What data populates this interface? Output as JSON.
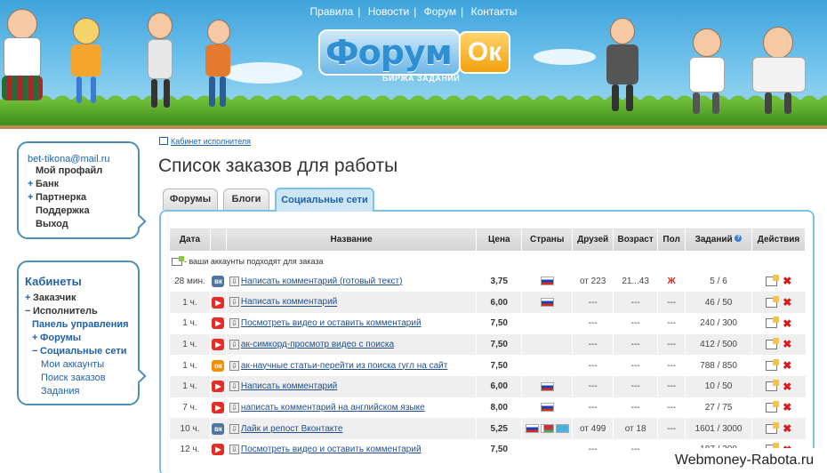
{
  "header": {
    "nav": [
      "Правила",
      "Новости",
      "Форум",
      "Контакты"
    ],
    "nav_sep": "|",
    "logo_main": "Форум",
    "logo_badge": "Ок",
    "logo_sub": "БИРЖА ЗАДАНИЙ"
  },
  "account": {
    "email": "bet-tikona@mail.ru",
    "items": [
      {
        "prefix": "",
        "label": "Мой профайл"
      },
      {
        "prefix": "+",
        "label": "Банк"
      },
      {
        "prefix": "+",
        "label": "Партнерка"
      },
      {
        "prefix": "",
        "label": "Поддержка"
      },
      {
        "prefix": "",
        "label": "Выход"
      }
    ]
  },
  "cabinets": {
    "title": "Кабинеты",
    "customer": {
      "prefix": "+",
      "label": "Заказчик"
    },
    "executor": {
      "prefix": "−",
      "label": "Исполнитель"
    },
    "control_panel": "Панель управления",
    "forums": {
      "prefix": "+",
      "label": "Форумы"
    },
    "social": {
      "prefix": "−",
      "label": "Социальные сети"
    },
    "social_items": [
      "Мои аккаунты",
      "Поиск заказов",
      "Задания"
    ]
  },
  "breadcrumb": "Кабинет исполнителя",
  "page_title": "Список заказов для работы",
  "tabs": [
    "Форумы",
    "Блоги",
    "Социальные сети"
  ],
  "table": {
    "headers": [
      "Дата",
      "",
      "Название",
      "Цена",
      "Страны",
      "Друзей",
      "Возраст",
      "Пол",
      "Заданий",
      "Действия"
    ],
    "help_mark": "?",
    "note": "- ваши аккаунты подходят для заказа",
    "rows": [
      {
        "date": "28 мин.",
        "service": "vk",
        "service_glyph": "вк",
        "name": "Написать комментарий (готовый текст)",
        "price": "3,75",
        "flags": [
          "ru"
        ],
        "friends": "от 223",
        "age": "21...43",
        "gender": "Ж",
        "tasks": "5 / 6"
      },
      {
        "date": "1 ч.",
        "service": "yt",
        "service_glyph": "▶",
        "name": "Написать комментарий",
        "price": "6,00",
        "flags": [
          "ru"
        ],
        "friends": "---",
        "age": "---",
        "gender": "---",
        "tasks": "46 / 50"
      },
      {
        "date": "1 ч.",
        "service": "yt",
        "service_glyph": "▶",
        "name": "Посмотреть видео и оставить комментарий",
        "price": "7,50",
        "flags": [],
        "friends": "---",
        "age": "---",
        "gender": "---",
        "tasks": "240 / 300"
      },
      {
        "date": "1 ч.",
        "service": "yt",
        "service_glyph": "▶",
        "name": "ак-симкорд-просмотр видео с поиска",
        "price": "7,50",
        "flags": [],
        "friends": "---",
        "age": "---",
        "gender": "---",
        "tasks": "412 / 500"
      },
      {
        "date": "1 ч.",
        "service": "ok",
        "service_glyph": "ок",
        "name": "ак-научные статьи-перейти из поиска гугл на сайт",
        "price": "7,50",
        "flags": [],
        "friends": "---",
        "age": "---",
        "gender": "---",
        "tasks": "788 / 850"
      },
      {
        "date": "1 ч.",
        "service": "yt",
        "service_glyph": "▶",
        "name": "Написать комментарий",
        "price": "6,00",
        "flags": [
          "ru"
        ],
        "friends": "---",
        "age": "---",
        "gender": "---",
        "tasks": "10 / 50"
      },
      {
        "date": "7 ч.",
        "service": "yt",
        "service_glyph": "▶",
        "name": "написать комментарий на английском языке",
        "price": "8,00",
        "flags": [
          "ru"
        ],
        "friends": "---",
        "age": "---",
        "gender": "---",
        "tasks": "27 / 75"
      },
      {
        "date": "10 ч.",
        "service": "vk",
        "service_glyph": "вк",
        "name": "Лайк и репост Вконтакте",
        "price": "5,25",
        "flags": [
          "ru",
          "by",
          "kz"
        ],
        "friends": "от 499",
        "age": "от 18",
        "gender": "---",
        "tasks": "1601 / 3000"
      },
      {
        "date": "12 ч.",
        "service": "yt",
        "service_glyph": "▶",
        "name": "Посмотреть видео и оставить комментарий",
        "price": "7,50",
        "flags": [],
        "friends": "---",
        "age": "---",
        "gender": "---",
        "tasks": "187 / 200"
      }
    ]
  },
  "watermark": "Webmoney-Rabota.ru",
  "colors": {
    "accent": "#1f62a8",
    "panel_border": "#7cc1e8",
    "sidebar_border": "#4a8fb5",
    "delete": "#d81c1c"
  }
}
